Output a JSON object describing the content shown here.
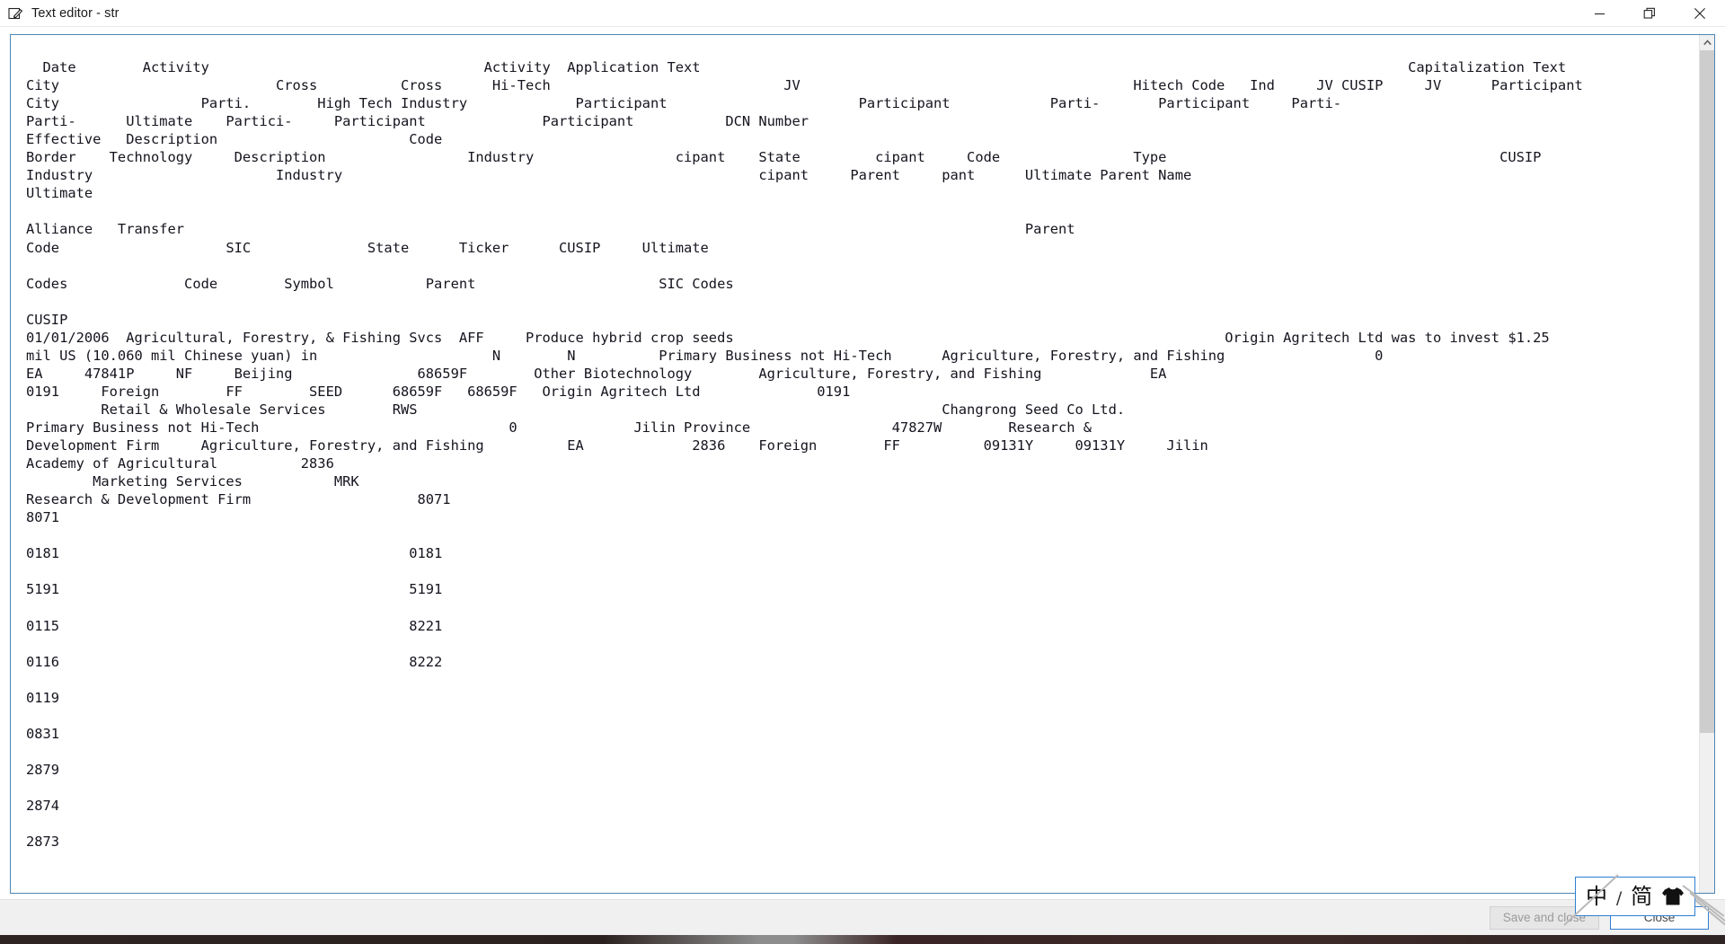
{
  "window": {
    "title": "Text editor - str",
    "app_icon": "edit-pencil-icon",
    "controls": {
      "minimize": "minimize-icon",
      "restore": "restore-icon",
      "close": "close-icon"
    }
  },
  "editor": {
    "filename": "str",
    "text": "\n  Date        Activity                                 Activity  Application Text                                                                                     Capitalization Text\nCity                          Cross          Cross      Hi-Tech                            JV                                        Hitech Code   Ind     JV CUSIP     JV      Participant\nCity                 Parti.        High Tech Industry             Participant                       Participant            Parti-       Participant     Parti-\nParti-      Ultimate    Partici-     Participant              Participant           DCN Number\nEffective   Description                       Code\nBorder    Technology     Description                 Industry                 cipant    State         cipant     Code                Type                                        CUSIP\nIndustry                      Industry                                                  cipant     Parent     pant      Ultimate Parent Name\nUltimate\n\nAlliance   Transfer                                                                                                     Parent\nCode                    SIC              State      Ticker      CUSIP     Ultimate\n\nCodes              Code        Symbol           Parent                      SIC Codes\n\nCUSIP\n01/01/2006  Agricultural, Forestry, & Fishing Svcs  AFF     Produce hybrid crop seeds                                                           Origin Agritech Ltd was to invest $1.25\nmil US (10.060 mil Chinese yuan) in                     N        N          Primary Business not Hi-Tech      Agriculture, Forestry, and Fishing                  0\nEA     47841P     NF     Beijing               68659F        Other Biotechnology        Agriculture, Forestry, and Fishing             EA\n0191     Foreign        FF        SEED      68659F   68659F   Origin Agritech Ltd              0191\n         Retail & Wholesale Services        RWS                                                               Changrong Seed Co Ltd.\nPrimary Business not Hi-Tech                              0              Jilin Province                 47827W        Research &\nDevelopment Firm     Agriculture, Forestry, and Fishing          EA             2836    Foreign        FF          09131Y     09131Y     Jilin\nAcademy of Agricultural          2836\n        Marketing Services           MRK\nResearch & Development Firm                    8071\n8071\n\n0181                                          0181\n\n5191                                          5191\n\n0115                                          8221\n\n0116                                          8222\n\n0119\n\n0831\n\n2879\n\n2874\n\n2873\n"
  },
  "scrollbar": {
    "up_arrow": "chevron-up-icon",
    "down_arrow": "chevron-down-icon"
  },
  "footer": {
    "save_and_close_label": "Save and close",
    "close_label": "Close"
  },
  "ime": {
    "language_mode": "中",
    "separator": "/",
    "script_mode": "简",
    "shape_icon": "shirt-icon"
  },
  "colors": {
    "accent": "#2f7fd1",
    "editor_border": "#4b86b4",
    "text": "#14141e",
    "chrome": "#f0f0f0",
    "scrollbar_thumb": "#cdcdcd"
  }
}
